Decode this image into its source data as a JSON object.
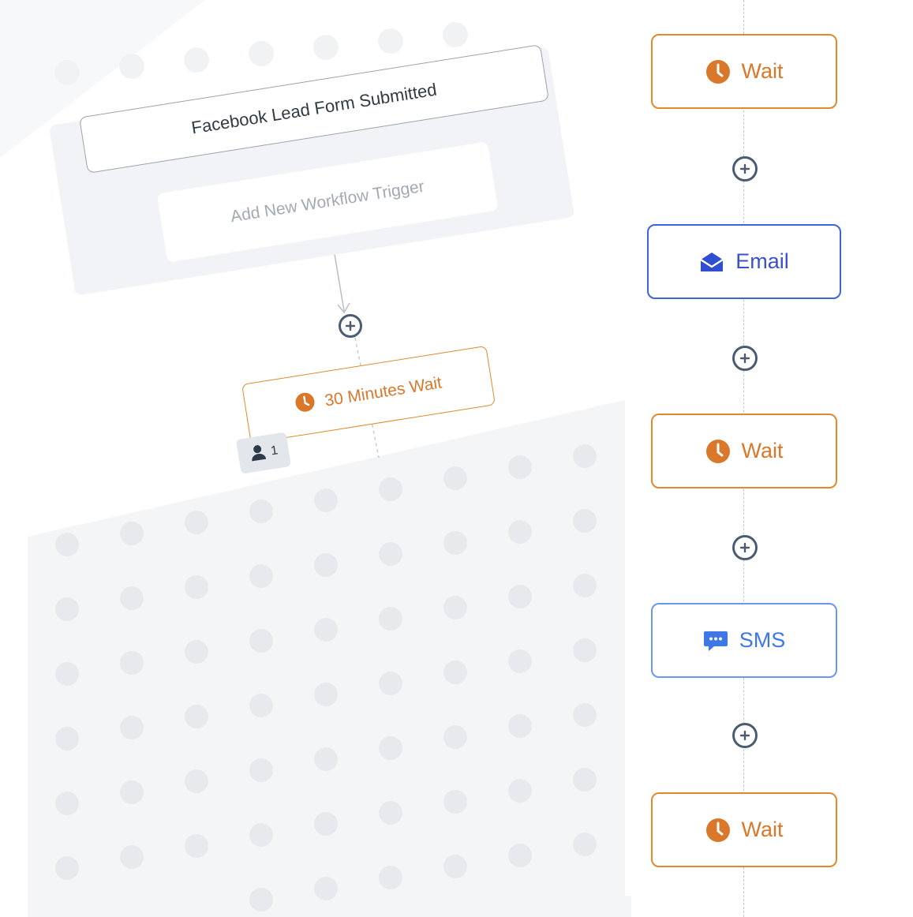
{
  "colors": {
    "wait_accent": "#e08a2c",
    "email_accent": "#3d63dd",
    "sms_accent": "#6a97f0",
    "plus_icon": "#4a5b72"
  },
  "left_canvas": {
    "trigger": {
      "label": "Facebook Lead Form Submitted"
    },
    "add_trigger": {
      "label": "Add New Workflow Trigger"
    },
    "first_action": {
      "label": "30 Minutes Wait",
      "icon": "clock-icon"
    },
    "contacts_badge": {
      "count": "1",
      "icon": "user-icon"
    }
  },
  "workflow_column": {
    "nodes": [
      {
        "type": "wait",
        "label": "Wait",
        "icon": "clock-icon"
      },
      {
        "type": "email",
        "label": "Email",
        "icon": "envelope-icon"
      },
      {
        "type": "wait",
        "label": "Wait",
        "icon": "clock-icon"
      },
      {
        "type": "sms",
        "label": "SMS",
        "icon": "chat-bubble-icon"
      },
      {
        "type": "wait",
        "label": "Wait",
        "icon": "clock-icon"
      }
    ],
    "add_step_icon": "plus-circle-icon"
  }
}
